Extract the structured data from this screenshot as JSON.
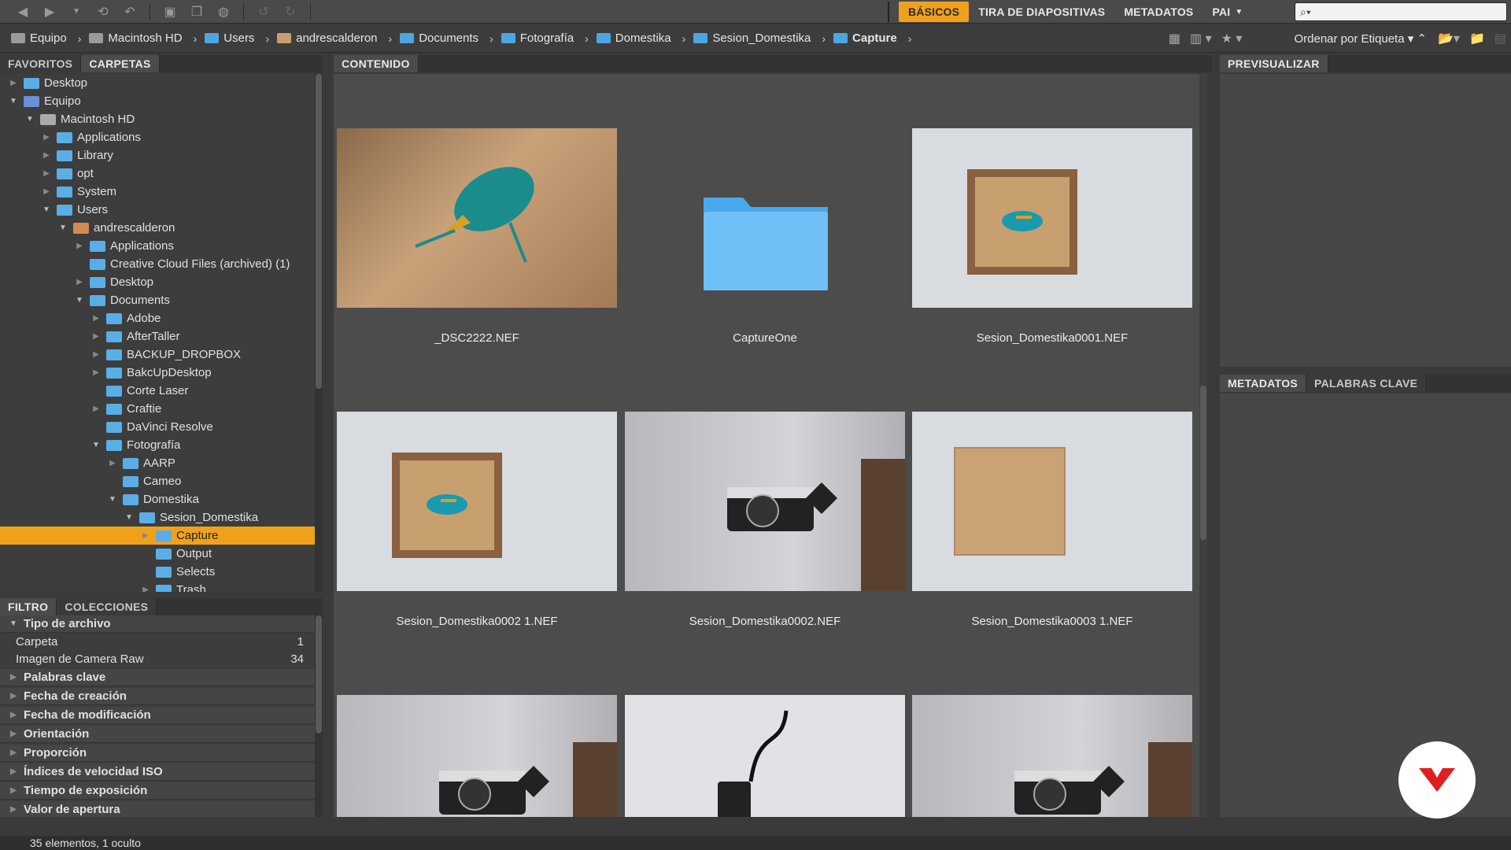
{
  "toolbar": {
    "workspaces": [
      "BÁSICOS",
      "TIRA DE DIAPOSITIVAS",
      "METADATOS",
      "PAI"
    ],
    "search_placeholder": "",
    "icons": [
      "back-icon",
      "forward-icon",
      "history-icon",
      "rotate-icon",
      "return-icon",
      "camera-icon",
      "copy-icon",
      "refine-icon",
      "undo-icon",
      "redo-icon"
    ]
  },
  "path": {
    "crumbs": [
      "Equipo",
      "Macintosh HD",
      "Users",
      "andrescalderon",
      "Documents",
      "Fotografía",
      "Domestika",
      "Sesion_Domestika",
      "Capture"
    ],
    "sort_label": "Ordenar por Etiqueta"
  },
  "left": {
    "tabs": [
      "FAVORITOS",
      "CARPETAS"
    ],
    "tree": [
      {
        "label": "Desktop",
        "level": 0,
        "icon": "folder"
      },
      {
        "label": "Equipo",
        "level": 0,
        "icon": "computer",
        "open": true
      },
      {
        "label": "Macintosh HD",
        "level": 1,
        "icon": "drive",
        "open": true
      },
      {
        "label": "Applications",
        "level": 2,
        "icon": "folder"
      },
      {
        "label": "Library",
        "level": 2,
        "icon": "folder"
      },
      {
        "label": "opt",
        "level": 2,
        "icon": "folder"
      },
      {
        "label": "System",
        "level": 2,
        "icon": "folder"
      },
      {
        "label": "Users",
        "level": 2,
        "icon": "folder",
        "open": true
      },
      {
        "label": "andrescalderon",
        "level": 3,
        "icon": "home",
        "open": true
      },
      {
        "label": "Applications",
        "level": 4,
        "icon": "folder"
      },
      {
        "label": "Creative Cloud Files (archived) (1)",
        "level": 4,
        "icon": "folder",
        "noarrow": true
      },
      {
        "label": "Desktop",
        "level": 4,
        "icon": "folder"
      },
      {
        "label": "Documents",
        "level": 4,
        "icon": "folder",
        "open": true
      },
      {
        "label": "Adobe",
        "level": 5,
        "icon": "folder"
      },
      {
        "label": "AfterTaller",
        "level": 5,
        "icon": "folder"
      },
      {
        "label": "BACKUP_DROPBOX",
        "level": 5,
        "icon": "folder"
      },
      {
        "label": "BakcUpDesktop",
        "level": 5,
        "icon": "folder"
      },
      {
        "label": "Corte Laser",
        "level": 5,
        "icon": "folder",
        "noarrow": true
      },
      {
        "label": "Craftie",
        "level": 5,
        "icon": "folder"
      },
      {
        "label": "DaVinci Resolve",
        "level": 5,
        "icon": "folder",
        "noarrow": true
      },
      {
        "label": "Fotografía",
        "level": 5,
        "icon": "folder",
        "open": true
      },
      {
        "label": "AARP",
        "level": 6,
        "icon": "folder"
      },
      {
        "label": "Cameo",
        "level": 6,
        "icon": "folder",
        "noarrow": true
      },
      {
        "label": "Domestika",
        "level": 6,
        "icon": "folder",
        "open": true
      },
      {
        "label": "Sesion_Domestika",
        "level": 7,
        "icon": "folder",
        "open": true
      },
      {
        "label": "Capture",
        "level": 8,
        "icon": "folder",
        "selected": true
      },
      {
        "label": "Output",
        "level": 8,
        "icon": "folder",
        "noarrow": true
      },
      {
        "label": "Selects",
        "level": 8,
        "icon": "folder",
        "noarrow": true
      },
      {
        "label": "Trash",
        "level": 8,
        "icon": "folder"
      }
    ],
    "filter_tabs": [
      "FILTRO",
      "COLECCIONES"
    ],
    "filter": {
      "file_type_heading": "Tipo de archivo",
      "items": [
        {
          "label": "Carpeta",
          "count": "1"
        },
        {
          "label": "Imagen de Camera Raw",
          "count": "34"
        }
      ],
      "sections": [
        "Palabras clave",
        "Fecha de creación",
        "Fecha de modificación",
        "Orientación",
        "Proporción",
        "Índices de velocidad ISO",
        "Tiempo de exposición",
        "Valor de apertura"
      ]
    }
  },
  "content": {
    "tab": "CONTENIDO",
    "items": [
      {
        "label": "_DSC2222.NEF",
        "kind": "beetle-close"
      },
      {
        "label": "CaptureOne",
        "kind": "folder"
      },
      {
        "label": "Sesion_Domestika0001.NEF",
        "kind": "frame-beetle"
      },
      {
        "label": "Sesion_Domestika0002 1.NEF",
        "kind": "frame-beetle"
      },
      {
        "label": "Sesion_Domestika0002.NEF",
        "kind": "camera"
      },
      {
        "label": "Sesion_Domestika0003 1.NEF",
        "kind": "frame-empty"
      },
      {
        "label": "",
        "kind": "camera"
      },
      {
        "label": "",
        "kind": "camera-strap"
      },
      {
        "label": "",
        "kind": "camera"
      }
    ]
  },
  "right": {
    "preview_tab": "PREVISUALIZAR",
    "meta_tabs": [
      "METADATOS",
      "PALABRAS CLAVE"
    ]
  },
  "status": "35 elementos, 1 oculto",
  "colors": {
    "accent": "#f0a11c",
    "folder": "#5aaee6",
    "logo": "#e02020"
  }
}
